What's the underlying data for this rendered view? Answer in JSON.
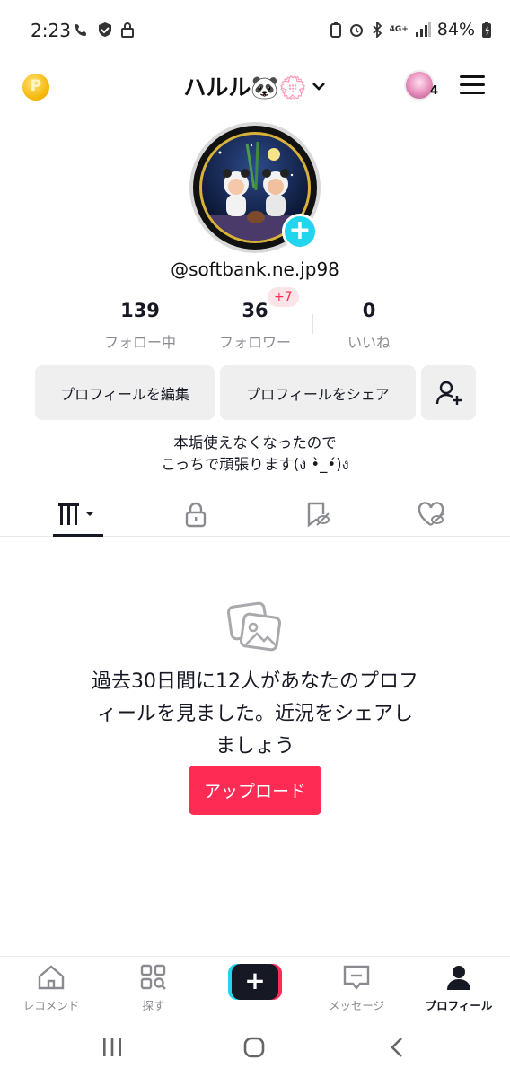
{
  "status_bar": {
    "time": "2:23",
    "battery": "84%",
    "network": "4G+"
  },
  "header": {
    "username": "ハルル🐼💮",
    "following_avatar_count": "4"
  },
  "profile": {
    "handle": "@softbank.ne.jp98",
    "stats": [
      {
        "value": "139",
        "label": "フォロー中"
      },
      {
        "value": "36",
        "label": "フォロワー"
      },
      {
        "value": "0",
        "label": "いいね"
      }
    ],
    "new_followers_badge": "+7",
    "edit_button": "プロフィールを編集",
    "share_button": "プロフィールをシェア",
    "bio_line1": "本垢使えなくなったので",
    "bio_line2": "こっちで頑張ります(ง •̀_•́)ง"
  },
  "tabs": [
    {
      "icon": "videos-grid-icon",
      "active": true
    },
    {
      "icon": "lock-icon",
      "active": false
    },
    {
      "icon": "favorites-icon",
      "active": false
    },
    {
      "icon": "liked-icon",
      "active": false
    }
  ],
  "empty_state": {
    "message": "過去30日間に12人があなたのプロフィールを見ました。近況をシェアしましょう",
    "upload_button": "アップロード"
  },
  "bottom_nav": [
    {
      "label": "レコメンド",
      "icon": "home-icon"
    },
    {
      "label": "探す",
      "icon": "explore-icon"
    },
    {
      "label": "",
      "icon": "create-icon"
    },
    {
      "label": "メッセージ",
      "icon": "inbox-icon"
    },
    {
      "label": "プロフィール",
      "icon": "profile-icon",
      "active": true
    }
  ],
  "colors": {
    "accent": "#fe2c55",
    "cyan": "#20d5ec",
    "text": "#161823",
    "muted": "#8a8b91"
  }
}
